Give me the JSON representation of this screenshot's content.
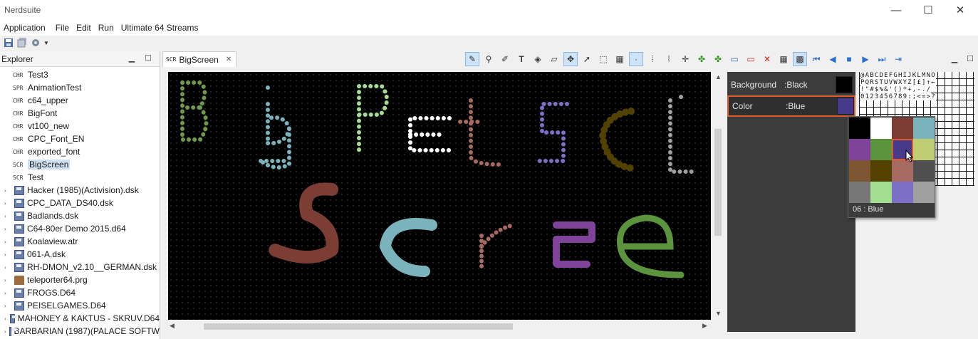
{
  "window": {
    "title": "Nerdsuite",
    "minimize": "—",
    "maximize": "☐",
    "close": "✕"
  },
  "menu": [
    "Application",
    "File",
    "Edit",
    "Run",
    "Ultimate 64 Streams"
  ],
  "explorer": {
    "title": "Explorer",
    "items": [
      {
        "tag": "CHR",
        "label": "Test3",
        "kind": "file"
      },
      {
        "tag": "SPR",
        "label": "AnimationTest",
        "kind": "file"
      },
      {
        "tag": "CHR",
        "label": "c64_upper",
        "kind": "file"
      },
      {
        "tag": "CHR",
        "label": "BigFont",
        "kind": "file"
      },
      {
        "tag": "CHR",
        "label": "vt100_new",
        "kind": "file"
      },
      {
        "tag": "CHR",
        "label": "CPC_Font_EN",
        "kind": "file"
      },
      {
        "tag": "CHR",
        "label": "exported_font",
        "kind": "file"
      },
      {
        "tag": "SCR",
        "label": "BigScreen",
        "kind": "file",
        "selected": true
      },
      {
        "tag": "SCR",
        "label": "Test",
        "kind": "file"
      },
      {
        "tag": "",
        "label": "Hacker (1985)(Activision).dsk",
        "kind": "disk"
      },
      {
        "tag": "",
        "label": "CPC_DATA_DS40.dsk",
        "kind": "disk"
      },
      {
        "tag": "",
        "label": "Badlands.dsk",
        "kind": "disk"
      },
      {
        "tag": "",
        "label": "C64-80er Demo 2015.d64",
        "kind": "disk"
      },
      {
        "tag": "",
        "label": "Koalaview.atr",
        "kind": "disk"
      },
      {
        "tag": "",
        "label": "061-A.dsk",
        "kind": "disk"
      },
      {
        "tag": "",
        "label": "RH-DMON_v2.10__GERMAN.dsk",
        "kind": "disk"
      },
      {
        "tag": "",
        "label": "teleporter64.prg",
        "kind": "prg"
      },
      {
        "tag": "",
        "label": "FROGS.D64",
        "kind": "disk"
      },
      {
        "tag": "",
        "label": "PEISELGAMES.D64",
        "kind": "disk"
      },
      {
        "tag": "",
        "label": "MAHONEY & KAKTUS - SKRUV.D64",
        "kind": "disk"
      },
      {
        "tag": "",
        "label": "BARBARIAN (1987)(PALACE SOFTW",
        "kind": "disk"
      }
    ]
  },
  "editor": {
    "tab_tag": "SCR",
    "tab_label": "BigScreen",
    "canvas_text_line1": "Big Petscii",
    "canvas_text_line2": "Screen"
  },
  "properties": {
    "background_label": "Background",
    "background_value": ":Black",
    "background_color": "#000000",
    "color_label": "Color",
    "color_value": ":Blue",
    "color_color": "#483a8a"
  },
  "charset_rows": [
    "@ABCDEFGHIJKLMNO",
    "PQRSTUVWXYZ[£]↑←",
    " !\"#$%&'()*+,-./",
    "0123456789:;<=>?"
  ],
  "palette": {
    "colors": [
      "#000000",
      "#ffffff",
      "#7b3d34",
      "#7ab3bb",
      "#7f4499",
      "#5c943e",
      "#483a8a",
      "#bfcd73",
      "#7e5732",
      "#524100",
      "#a76a62",
      "#4f4f4f",
      "#777777",
      "#a3dd8f",
      "#7c6fc5",
      "#9f9f9f"
    ],
    "selected_index": 6,
    "label": "06 : Blue"
  }
}
